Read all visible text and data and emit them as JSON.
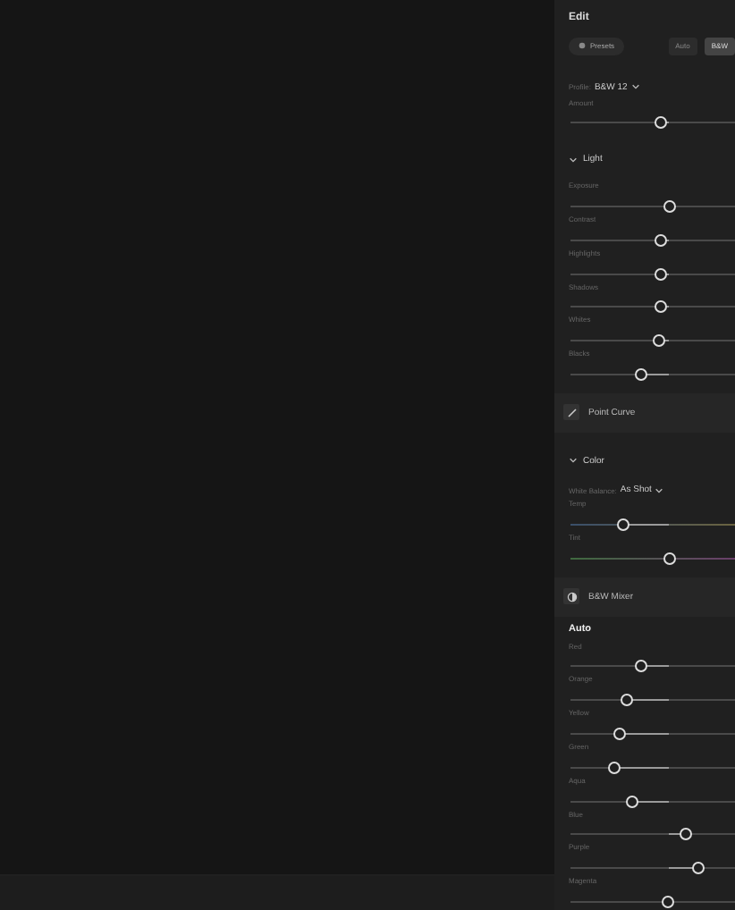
{
  "panel": {
    "title": "Edit",
    "presets_button": "Presets",
    "mode_buttons": [
      {
        "label": "Auto",
        "selected": false
      },
      {
        "label": "B&W",
        "selected": true
      }
    ],
    "profile": {
      "label": "Profile:",
      "value": "B&W 12"
    },
    "amount": {
      "label": "Amount",
      "level": 0.55
    },
    "sections": [
      {
        "kind": "group",
        "title": "Light",
        "expanded": true,
        "rows": [
          {
            "kind": "slider",
            "label": "Exposure",
            "level": 0.6
          },
          {
            "kind": "slider",
            "label": "Contrast",
            "level": 0.55
          },
          {
            "kind": "slider",
            "label": "Highlights",
            "level": 0.55
          },
          {
            "kind": "slider",
            "label": "Shadows",
            "level": 0.55
          },
          {
            "kind": "slider",
            "label": "Whites",
            "level": 0.54
          },
          {
            "kind": "slider",
            "label": "Blacks",
            "level": 0.43
          }
        ]
      },
      {
        "kind": "tool",
        "title": "Point Curve"
      },
      {
        "kind": "group",
        "title": "Color",
        "expanded": true,
        "rows": [
          {
            "kind": "select",
            "label": "White Balance:",
            "value": "As Shot"
          },
          {
            "kind": "temp",
            "label": "Temp",
            "level": 0.32
          },
          {
            "kind": "tint",
            "label": "Tint",
            "level": 0.6
          }
        ]
      },
      {
        "kind": "mixer",
        "title": "B&W Mixer",
        "subtitle": "Auto",
        "rows": [
          {
            "kind": "slider",
            "label": "Red",
            "level": 0.43
          },
          {
            "kind": "slider",
            "label": "Orange",
            "level": 0.34
          },
          {
            "kind": "slider",
            "label": "Yellow",
            "level": 0.3
          },
          {
            "kind": "slider",
            "label": "Green",
            "level": 0.27
          },
          {
            "kind": "slider",
            "label": "Aqua",
            "level": 0.38
          },
          {
            "kind": "slider",
            "label": "Blue",
            "level": 0.7
          },
          {
            "kind": "slider",
            "label": "Purple",
            "level": 0.78
          },
          {
            "kind": "slider",
            "label": "Magenta",
            "level": 0.59
          }
        ]
      }
    ]
  }
}
